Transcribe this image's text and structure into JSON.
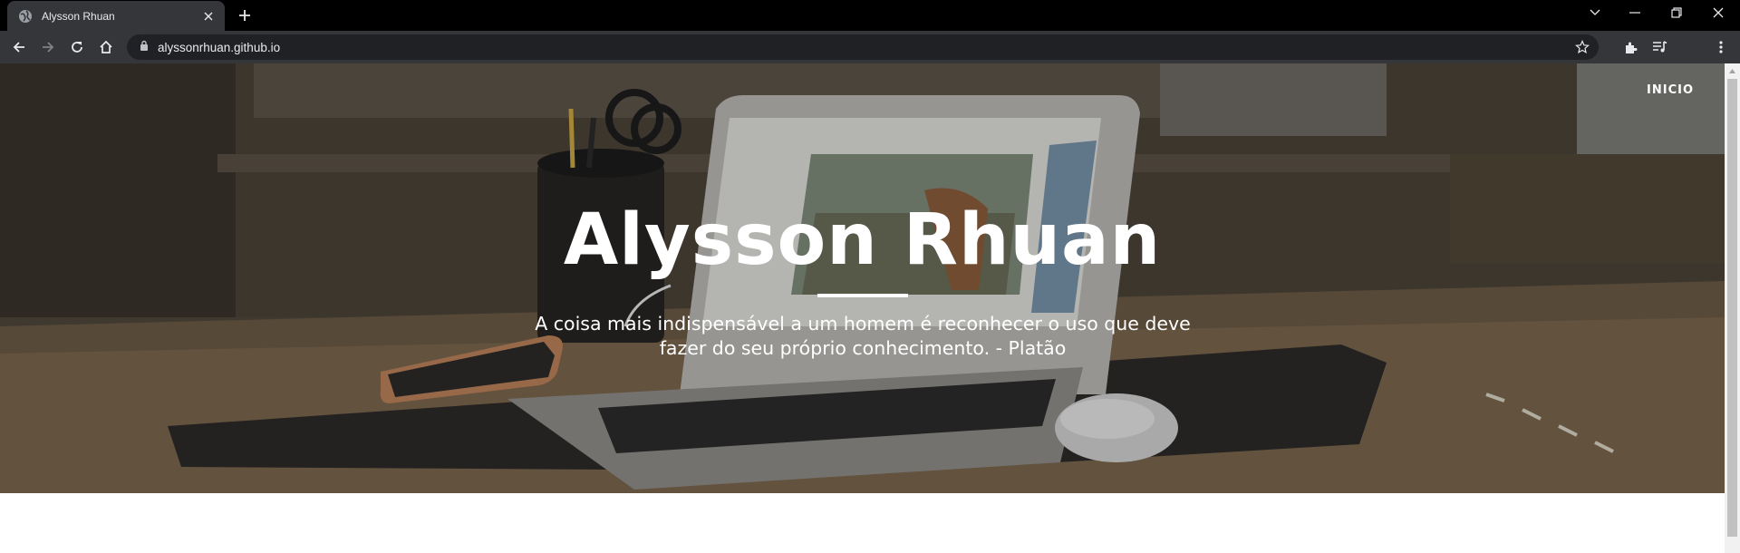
{
  "browser": {
    "tab": {
      "title": "Alysson Rhuan",
      "favicon": "globe-icon"
    },
    "address_bar": {
      "url": "alyssonrhuan.github.io",
      "lock": "lock-icon"
    },
    "colors": {
      "tabbar": "#000000",
      "toolbar": "#35363a",
      "omnibox": "#202124"
    }
  },
  "page": {
    "nav": {
      "link_label": "INICIO"
    },
    "hero": {
      "title": "Alysson Rhuan",
      "quote": "A coisa mais indispensável a um homem é reconhecer o uso que deve fazer do seu próprio conhecimento. - Platão"
    }
  }
}
